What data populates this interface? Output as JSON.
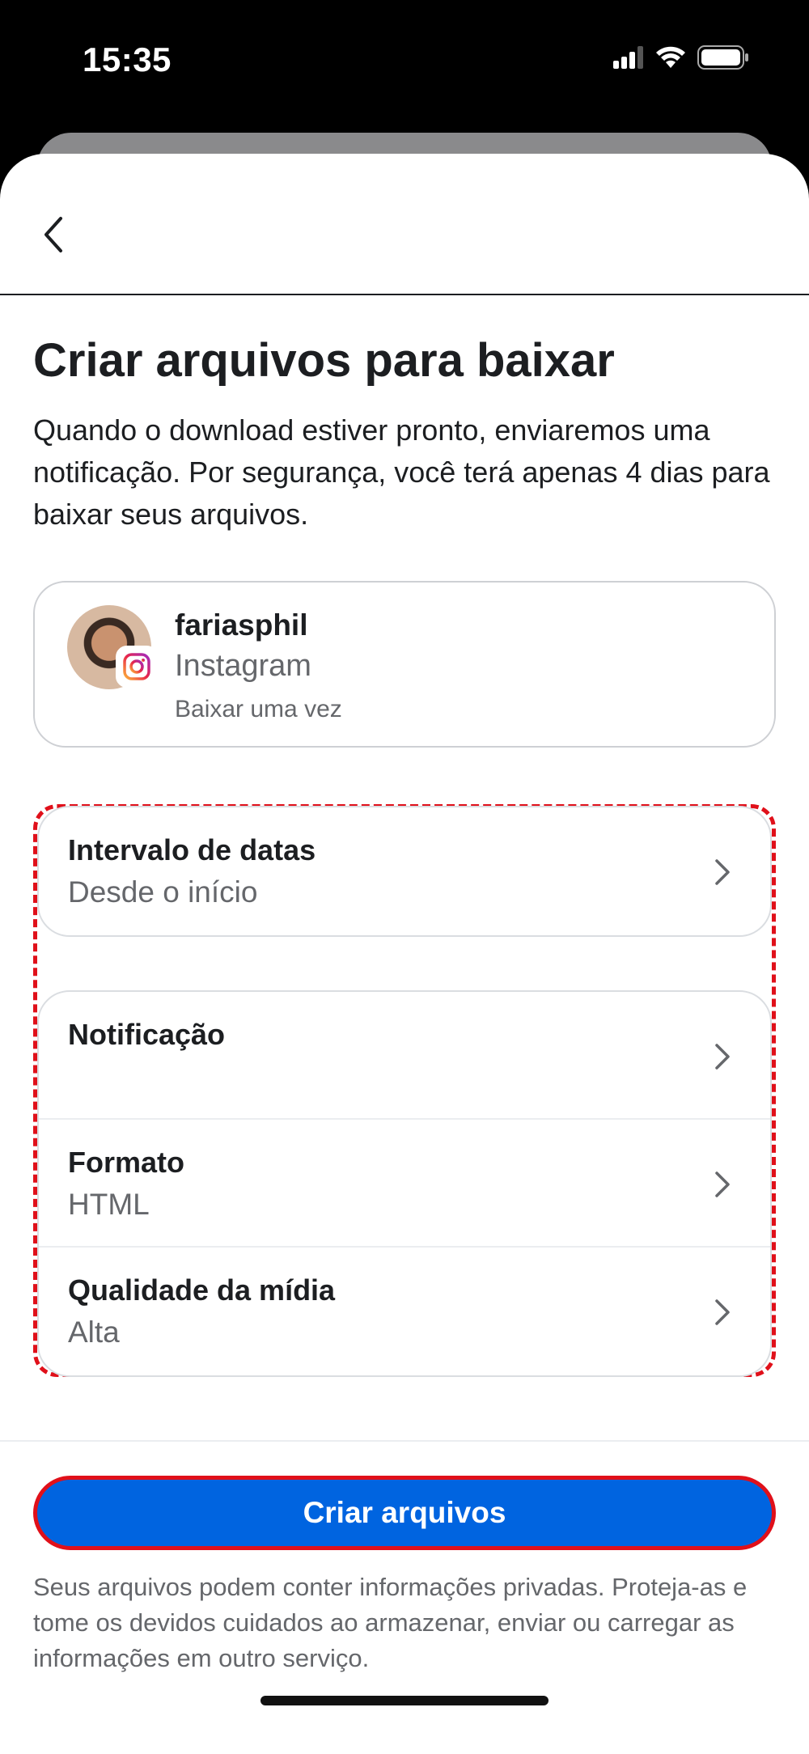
{
  "status_bar": {
    "time": "15:35",
    "icons": [
      "signal-icon",
      "wifi-icon",
      "battery-icon"
    ]
  },
  "header": {
    "back_icon": "chevron-left-icon"
  },
  "page": {
    "title": "Criar arquivos para baixar",
    "description": "Quando o download estiver pronto, enviaremos uma notificação. Por segurança, você terá apenas 4 dias para baixar seus arquivos."
  },
  "account": {
    "username": "fariasphil",
    "platform": "Instagram",
    "note": "Baixar uma vez",
    "badge_icon": "instagram-icon"
  },
  "settings": {
    "date_range": {
      "label": "Intervalo de datas",
      "value": "Desde o início"
    },
    "notification": {
      "label": "Notificação",
      "value": ""
    },
    "format": {
      "label": "Formato",
      "value": "HTML"
    },
    "media_quality": {
      "label": "Qualidade da mídia",
      "value": "Alta"
    }
  },
  "actions": {
    "create_label": "Criar arquivos"
  },
  "footer": {
    "note": "Seus arquivos podem conter informações privadas. Proteja-as e tome os devidos cuidados ao armazenar, enviar ou carregar as informações em outro serviço."
  },
  "colors": {
    "primary": "#0064e0",
    "highlight": "#e0101a",
    "text": "#1c1e21",
    "secondary_text": "#65676b"
  }
}
